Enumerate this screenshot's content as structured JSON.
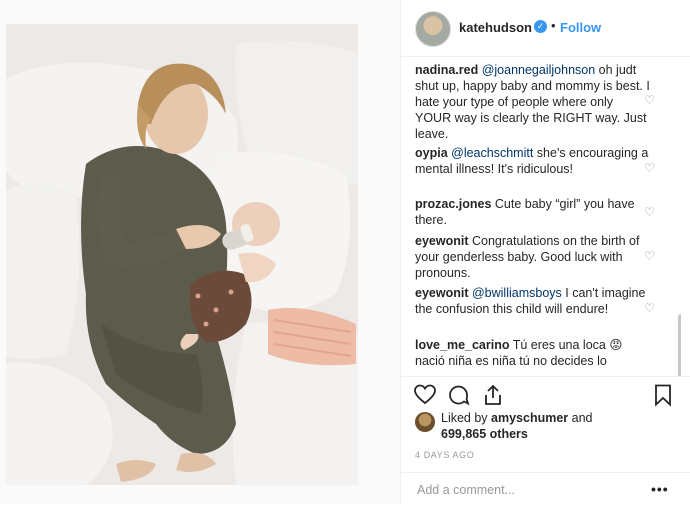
{
  "post": {
    "username": "katehudson",
    "follow_label": "Follow",
    "dot": "•"
  },
  "comments": [
    {
      "user": "nadina.red",
      "mention": "@joannegailjohnson",
      "text": " oh judt shut up, happy baby and mommy is best. I hate your type of people where only YOUR way is clearly the RIGHT way. Just leave."
    },
    {
      "user": "oypia",
      "mention": "@leachschmitt",
      "text": " she's encouraging a mental illness! It's ridiculous!"
    },
    {
      "user": "prozac.jones",
      "mention": "",
      "text": " Cute baby “girl” you have there."
    },
    {
      "user": "eyewonit",
      "mention": "",
      "text": " Congratulations on the birth of your genderless baby. Good luck with pronouns."
    },
    {
      "user": "eyewonit",
      "mention": "@bwilliamsboys",
      "text": " I can't imagine the confusion this child will endure!"
    },
    {
      "user": "love_me_carino",
      "mention": "",
      "text": " Tú eres una loca 😡 nació niña es niña tú no decides lo"
    }
  ],
  "likes": {
    "prefix": "Liked by ",
    "user": "amyschumer",
    "middle": " and",
    "count": "699,865 others"
  },
  "timestamp": "4 DAYS AGO",
  "add_comment_placeholder": "Add a comment...",
  "more_label": "•••",
  "icons": {
    "heart": "heart-icon",
    "comment": "comment-icon",
    "share": "share-icon",
    "save": "bookmark-icon",
    "verified": "verified-badge-icon"
  },
  "colors": {
    "link_blue": "#3897f0",
    "mention": "#003569",
    "muted": "#999999"
  }
}
